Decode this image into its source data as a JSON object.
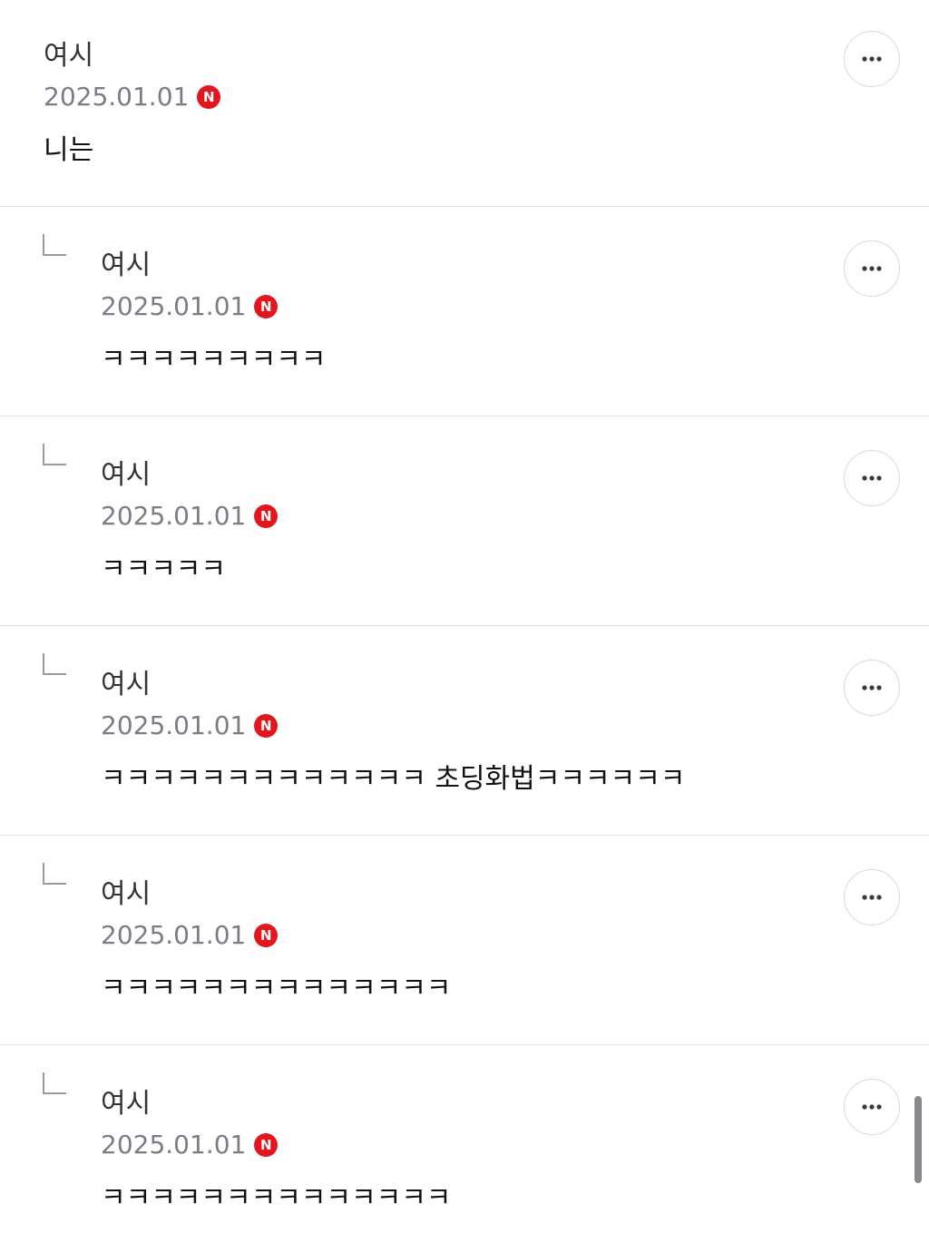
{
  "comments": [
    {
      "author": "여시",
      "date": "2025.01.01",
      "badge": "N",
      "text": "니는",
      "is_reply": false,
      "more_icon": "more-horizontal-icon"
    },
    {
      "author": "여시",
      "date": "2025.01.01",
      "badge": "N",
      "text": "ㅋㅋㅋㅋㅋㅋㅋㅋㅋ",
      "is_reply": true,
      "more_icon": "more-horizontal-icon"
    },
    {
      "author": "여시",
      "date": "2025.01.01",
      "badge": "N",
      "text": "ㅋㅋㅋㅋㅋ",
      "is_reply": true,
      "more_icon": "more-horizontal-icon"
    },
    {
      "author": "여시",
      "date": "2025.01.01",
      "badge": "N",
      "text": "ㅋㅋㅋㅋㅋㅋㅋㅋㅋㅋㅋㅋㅋ 초딩화법ㅋㅋㅋㅋㅋㅋ",
      "is_reply": true,
      "more_icon": "more-horizontal-icon"
    },
    {
      "author": "여시",
      "date": "2025.01.01",
      "badge": "N",
      "text": "ㅋㅋㅋㅋㅋㅋㅋㅋㅋㅋㅋㅋㅋㅋ",
      "is_reply": true,
      "more_icon": "more-horizontal-icon"
    },
    {
      "author": "여시",
      "date": "2025.01.01",
      "badge": "N",
      "text": "ㅋㅋㅋㅋㅋㅋㅋㅋㅋㅋㅋㅋㅋㅋ",
      "is_reply": true,
      "more_icon": "more-horizontal-icon"
    }
  ],
  "colors": {
    "badge": "#e3161d",
    "date": "#7b7d86",
    "divider": "#e4e4e6"
  }
}
